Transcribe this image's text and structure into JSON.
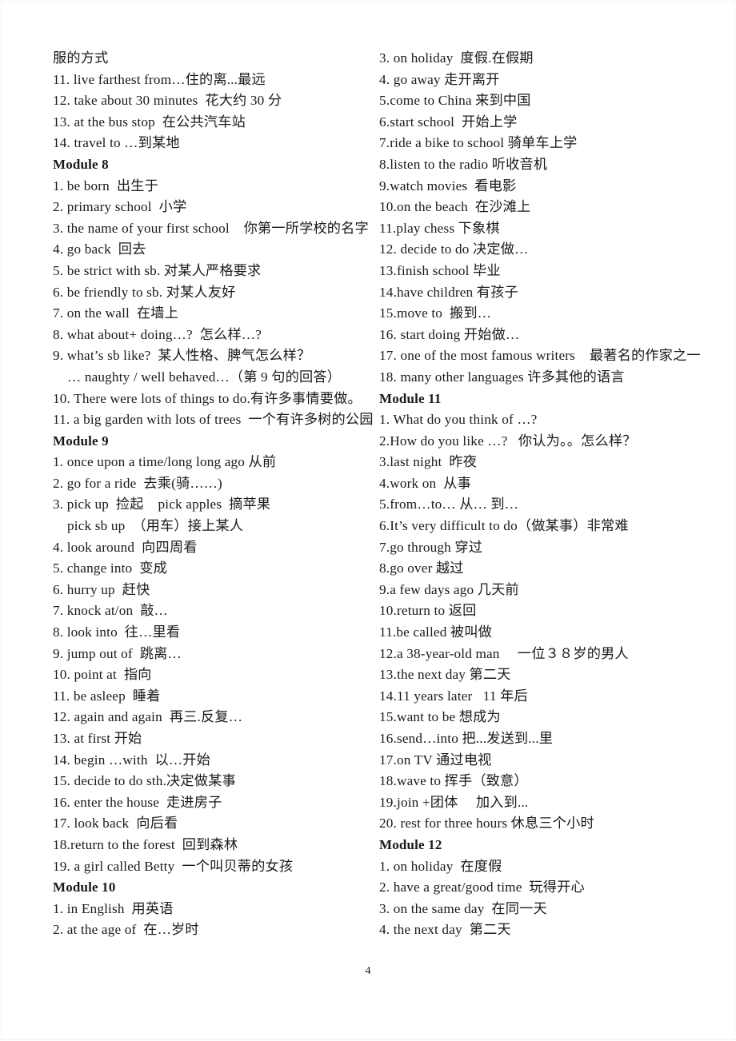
{
  "document": {
    "page_number": "4"
  },
  "left_column": {
    "lines": [
      {
        "text": "服的方式",
        "type": "body"
      },
      {
        "text": "11. live farthest from…住的离...最远",
        "type": "body"
      },
      {
        "text": "12. take about 30 minutes  花大约 30 分",
        "type": "body"
      },
      {
        "text": "13. at the bus stop  在公共汽车站",
        "type": "body"
      },
      {
        "text": "14. travel to …到某地",
        "type": "body"
      },
      {
        "text": "Module 8",
        "type": "heading"
      },
      {
        "text": "1. be born  出生于",
        "type": "body"
      },
      {
        "text": "2. primary school  小学",
        "type": "body"
      },
      {
        "text": "3. the name of your first school    你第一所学校的名字",
        "type": "body"
      },
      {
        "text": "4. go back  回去",
        "type": "body"
      },
      {
        "text": "5. be strict with sb. 对某人严格要求",
        "type": "body"
      },
      {
        "text": "6. be friendly to sb. 对某人友好",
        "type": "body"
      },
      {
        "text": "7. on the wall  在墙上",
        "type": "body"
      },
      {
        "text": "8. what about+ doing…?  怎么样…?",
        "type": "body"
      },
      {
        "text": "9. what’s sb like?  某人性格、脾气怎么样？",
        "type": "body"
      },
      {
        "text": "… naughty / well behaved…（第 9 句的回答）",
        "type": "indent"
      },
      {
        "text": "10. There were lots of things to do.有许多事情要做。",
        "type": "body"
      },
      {
        "text": "11. a big garden with lots of trees  一个有许多树的公园",
        "type": "body"
      },
      {
        "text": "Module 9",
        "type": "heading"
      },
      {
        "text": "1. once upon a time/long long ago 从前",
        "type": "body"
      },
      {
        "text": "2. go for a ride  去乘(骑……)",
        "type": "body"
      },
      {
        "text": "3. pick up  捡起    pick apples  摘苹果",
        "type": "body"
      },
      {
        "text": "pick sb up  （用车）接上某人",
        "type": "indent"
      },
      {
        "text": "4. look around  向四周看",
        "type": "body"
      },
      {
        "text": "5. change into  变成",
        "type": "body"
      },
      {
        "text": "6. hurry up  赶快",
        "type": "body"
      },
      {
        "text": "7. knock at/on  敲…",
        "type": "body"
      },
      {
        "text": "8. look into  往…里看",
        "type": "body"
      },
      {
        "text": "9. jump out of  跳离…",
        "type": "body"
      },
      {
        "text": "10. point at  指向",
        "type": "body"
      },
      {
        "text": "11. be asleep  睡着",
        "type": "body"
      },
      {
        "text": "12. again and again  再三.反复…",
        "type": "body"
      },
      {
        "text": "13. at first 开始",
        "type": "body"
      },
      {
        "text": "14. begin …with  以…开始",
        "type": "body"
      },
      {
        "text": "15. decide to do sth.决定做某事",
        "type": "body"
      },
      {
        "text": "16. enter the house  走进房子",
        "type": "body"
      },
      {
        "text": "17. look back  向后看",
        "type": "body"
      },
      {
        "text": "18.return to the forest  回到森林",
        "type": "body"
      },
      {
        "text": "19. a girl called Betty  一个叫贝蒂的女孩",
        "type": "body"
      },
      {
        "text": "Module 10",
        "type": "heading"
      },
      {
        "text": "1. in English  用英语",
        "type": "body"
      },
      {
        "text": "2. at the age of  在…岁时",
        "type": "body"
      }
    ]
  },
  "right_column": {
    "lines": [
      {
        "text": "3. on holiday  度假.在假期",
        "type": "body"
      },
      {
        "text": "4. go away 走开离开",
        "type": "body"
      },
      {
        "text": "5.come to China 来到中国",
        "type": "body"
      },
      {
        "text": "6.start school  开始上学",
        "type": "body"
      },
      {
        "text": "7.ride a bike to school 骑单车上学",
        "type": "body"
      },
      {
        "text": "8.listen to the radio 听收音机",
        "type": "body"
      },
      {
        "text": "9.watch movies  看电影",
        "type": "body"
      },
      {
        "text": "10.on the beach  在沙滩上",
        "type": "body"
      },
      {
        "text": "11.play chess 下象棋",
        "type": "body"
      },
      {
        "text": "12. decide to do 决定做…",
        "type": "body"
      },
      {
        "text": "13.finish school 毕业",
        "type": "body"
      },
      {
        "text": "14.have children 有孩子",
        "type": "body"
      },
      {
        "text": "15.move to  搬到…",
        "type": "body"
      },
      {
        "text": "16. start doing 开始做…",
        "type": "body"
      },
      {
        "text": "17. one of the most famous writers    最著名的作家之一",
        "type": "body"
      },
      {
        "text": "18. many other languages 许多其他的语言",
        "type": "body"
      },
      {
        "text": "Module 11",
        "type": "heading"
      },
      {
        "text": "1. What do you think of …?",
        "type": "body"
      },
      {
        "text": "2.How do you like …?   你认为。。怎么样？",
        "type": "body"
      },
      {
        "text": "3.last night  昨夜",
        "type": "body"
      },
      {
        "text": "4.work on  从事",
        "type": "body"
      },
      {
        "text": "5.from…to… 从… 到…",
        "type": "body"
      },
      {
        "text": "6.It’s very difficult to do（做某事）非常难",
        "type": "body"
      },
      {
        "text": "7.go through 穿过",
        "type": "body"
      },
      {
        "text": "8.go over 越过",
        "type": "body"
      },
      {
        "text": "9.a few days ago 几天前",
        "type": "body"
      },
      {
        "text": "10.return to 返回",
        "type": "body"
      },
      {
        "text": "11.be called 被叫做",
        "type": "body"
      },
      {
        "text": "12.a 38-year-old man     一位３８岁的男人",
        "type": "body"
      },
      {
        "text": "13.the next day 第二天",
        "type": "body"
      },
      {
        "text": "14.11 years later   11 年后",
        "type": "body"
      },
      {
        "text": "15.want to be 想成为",
        "type": "body"
      },
      {
        "text": "16.send…into 把...发送到...里",
        "type": "body"
      },
      {
        "text": "17.on TV 通过电视",
        "type": "body"
      },
      {
        "text": "18.wave to 挥手（致意）",
        "type": "body"
      },
      {
        "text": "19.join +团体     加入到...",
        "type": "body"
      },
      {
        "text": "20. rest for three hours 休息三个小时",
        "type": "body"
      },
      {
        "text": "Module 12",
        "type": "heading"
      },
      {
        "text": "1. on holiday  在度假",
        "type": "body"
      },
      {
        "text": "2. have a great/good time  玩得开心",
        "type": "body"
      },
      {
        "text": "3. on the same day  在同一天",
        "type": "body"
      },
      {
        "text": "4. the next day  第二天",
        "type": "body"
      }
    ]
  }
}
